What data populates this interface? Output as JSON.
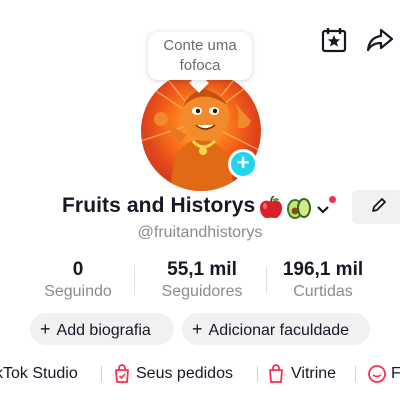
{
  "header": {
    "icons": [
      "calendar-star-icon",
      "share-icon"
    ]
  },
  "tooltip": {
    "line1": "Conte uma",
    "line2": "fofoca"
  },
  "profile": {
    "name": "Fruits and Historys",
    "emojis": [
      "apple",
      "avocado"
    ],
    "username": "@fruitandhistorys",
    "accent": "#fe2c55",
    "badge_color": "#20d5ec"
  },
  "stats": [
    {
      "value": "0",
      "label": "Seguindo"
    },
    {
      "value": "55,1 mil",
      "label": "Seguidores"
    },
    {
      "value": "196,1 mil",
      "label": "Curtidas"
    }
  ],
  "actions": {
    "add_bio": "Add biografia",
    "add_faculty": "Adicionar faculdade"
  },
  "links": {
    "studio": "kTok Studio",
    "orders": "Seus pedidos",
    "showcase": "Vitrine",
    "partial": "F"
  }
}
